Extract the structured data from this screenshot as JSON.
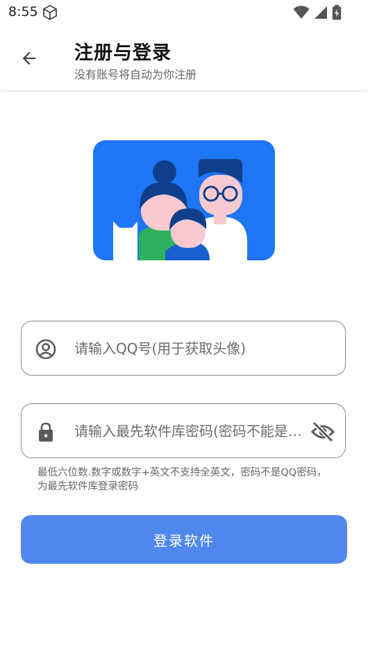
{
  "status_bar": {
    "time": "8:55"
  },
  "header": {
    "title": "注册与登录",
    "subtitle": "没有账号将自动为你注册"
  },
  "form": {
    "qq": {
      "placeholder": "请输入QQ号(用于获取头像)",
      "value": ""
    },
    "password": {
      "placeholder": "请输入最先软件库密码(密码不能是QQ密码)",
      "value": ""
    },
    "helper_text": "最低六位数.数字或数字+英文不支持全英文，密码不是QQ密码，为最先软件库登录密码",
    "submit_label": "登录软件"
  },
  "colors": {
    "hero_bg": "#1f76f5",
    "button_bg": "#5188ee",
    "field_border": "#8a8a8a"
  },
  "icons": [
    "cube-icon",
    "wifi-icon",
    "signal-icon",
    "battery-icon",
    "back-arrow-icon",
    "account-circle-icon",
    "lock-icon",
    "visibility-off-icon"
  ]
}
